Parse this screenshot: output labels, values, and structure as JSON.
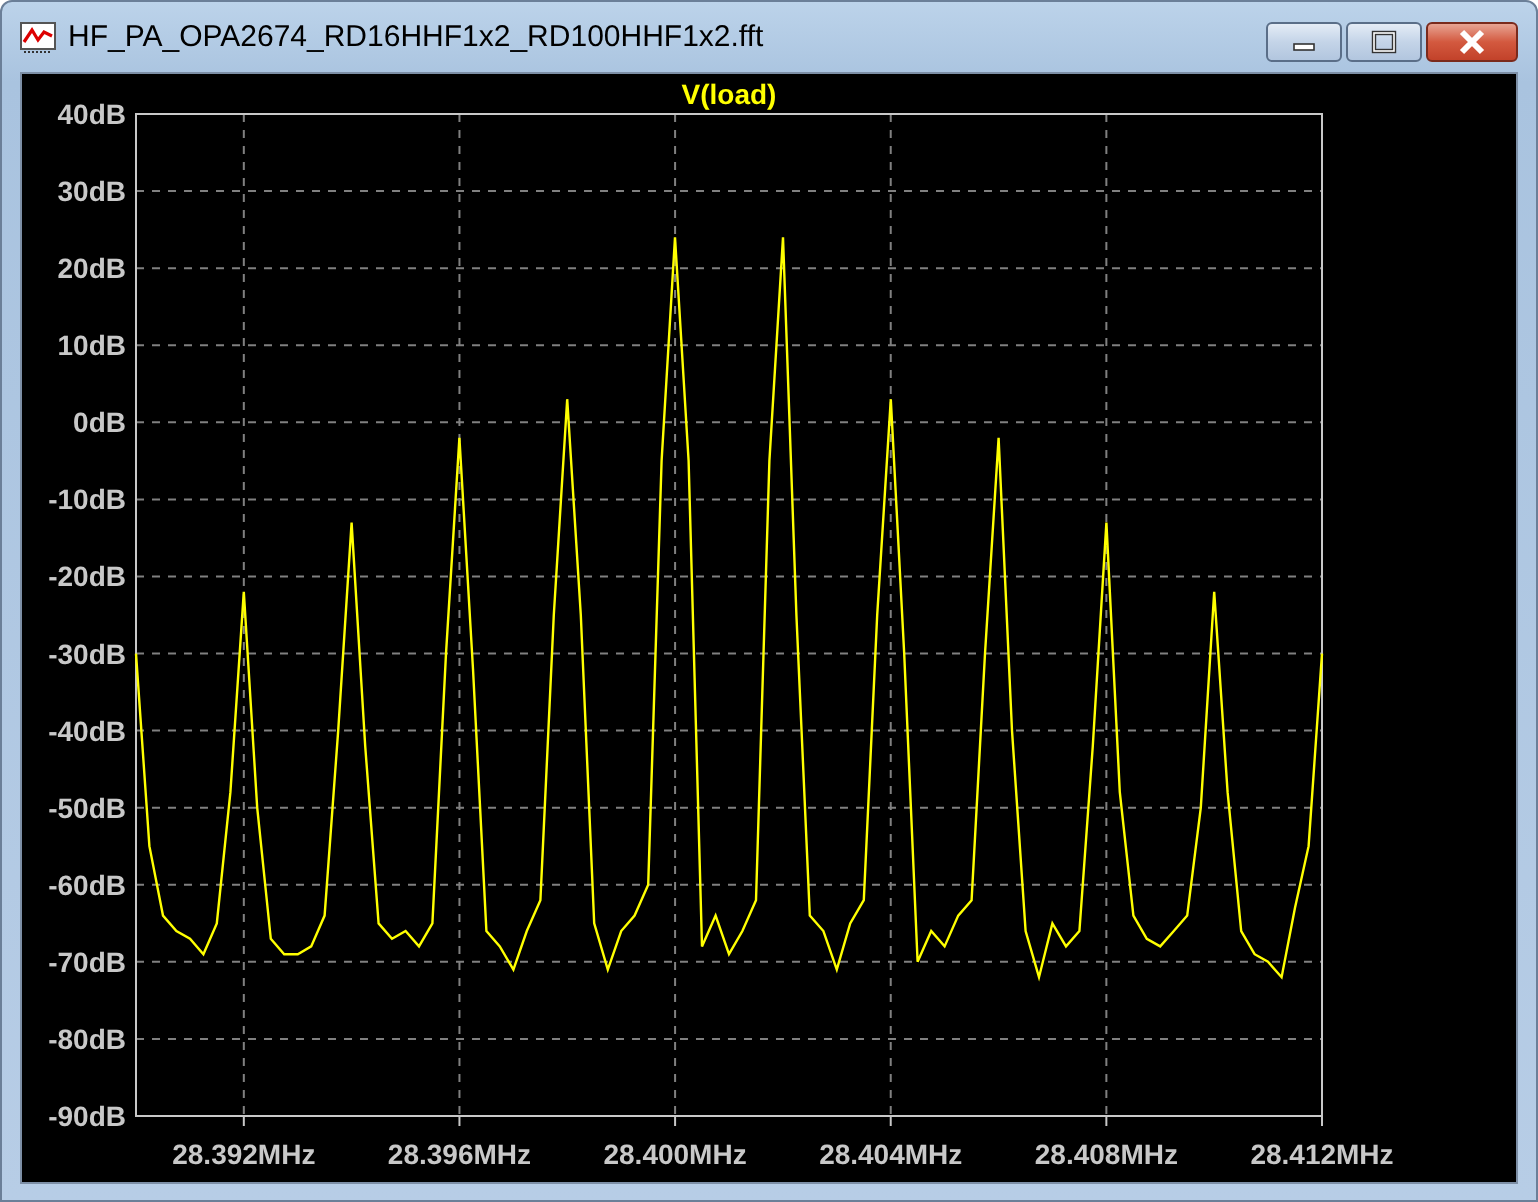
{
  "window": {
    "title": "HF_PA_OPA2674_RD16HHF1x2_RD100HHF1x2.fft"
  },
  "plot": {
    "chart_data": {
      "type": "line",
      "grid": true,
      "xlim": [
        28.39,
        28.412
      ],
      "ylim": [
        -90,
        40
      ],
      "xticks": [
        {
          "value": 28.392,
          "label": "28.392MHz"
        },
        {
          "value": 28.396,
          "label": "28.396MHz"
        },
        {
          "value": 28.4,
          "label": "28.400MHz"
        },
        {
          "value": 28.404,
          "label": "28.404MHz"
        },
        {
          "value": 28.408,
          "label": "28.408MHz"
        },
        {
          "value": 28.412,
          "label": "28.412MHz"
        }
      ],
      "yticks": [
        {
          "value": 40,
          "label": "40dB"
        },
        {
          "value": 30,
          "label": "30dB"
        },
        {
          "value": 20,
          "label": "20dB"
        },
        {
          "value": 10,
          "label": "10dB"
        },
        {
          "value": 0,
          "label": "0dB"
        },
        {
          "value": -10,
          "label": "-10dB"
        },
        {
          "value": -20,
          "label": "-20dB"
        },
        {
          "value": -30,
          "label": "-30dB"
        },
        {
          "value": -40,
          "label": "-40dB"
        },
        {
          "value": -50,
          "label": "-50dB"
        },
        {
          "value": -60,
          "label": "-60dB"
        },
        {
          "value": -70,
          "label": "-70dB"
        },
        {
          "value": -80,
          "label": "-80dB"
        },
        {
          "value": -90,
          "label": "-90dB"
        }
      ],
      "x": [
        28.39,
        28.39025,
        28.3905,
        28.39075,
        28.391,
        28.39125,
        28.3915,
        28.39175,
        28.392,
        28.39225,
        28.3925,
        28.39275,
        28.393,
        28.39325,
        28.3935,
        28.39375,
        28.394,
        28.39425,
        28.3945,
        28.39475,
        28.395,
        28.39525,
        28.3955,
        28.39575,
        28.396,
        28.39625,
        28.3965,
        28.39675,
        28.397,
        28.39725,
        28.3975,
        28.39775,
        28.398,
        28.39825,
        28.3985,
        28.39875,
        28.399,
        28.39925,
        28.3995,
        28.39975,
        28.4,
        28.40025,
        28.4005,
        28.40075,
        28.401,
        28.40125,
        28.4015,
        28.40175,
        28.402,
        28.40225,
        28.4025,
        28.40275,
        28.403,
        28.40325,
        28.4035,
        28.40375,
        28.404,
        28.40425,
        28.4045,
        28.40475,
        28.405,
        28.40525,
        28.4055,
        28.40575,
        28.406,
        28.40625,
        28.4065,
        28.40675,
        28.407,
        28.40725,
        28.4075,
        28.40775,
        28.408,
        28.40825,
        28.4085,
        28.40875,
        28.409,
        28.40925,
        28.4095,
        28.40975,
        28.41,
        28.41025,
        28.4105,
        28.41075,
        28.411,
        28.41125,
        28.4115,
        28.41175,
        28.412
      ],
      "series": [
        {
          "name": "V(load)",
          "color": "#ffff00",
          "values": [
            -30,
            -55,
            -64,
            -66,
            -67,
            -69,
            -65,
            -48,
            -22,
            -50,
            -67,
            -69,
            -69,
            -68,
            -64,
            -40,
            -13,
            -42,
            -65,
            -67,
            -66,
            -68,
            -65,
            -30,
            -2,
            -32,
            -66,
            -68,
            -71,
            -66,
            -62,
            -25,
            3,
            -25,
            -65,
            -71,
            -66,
            -64,
            -60,
            -5,
            24,
            -5,
            -68,
            -64,
            -69,
            -66,
            -62,
            -5,
            24,
            -25,
            -64,
            -66,
            -71,
            -65,
            -62,
            -25,
            3,
            -30,
            -70,
            -66,
            -68,
            -64,
            -62,
            -30,
            -2,
            -40,
            -66,
            -72,
            -65,
            -68,
            -66,
            -42,
            -13,
            -48,
            -64,
            -67,
            -68,
            -66,
            -64,
            -50,
            -22,
            -48,
            -66,
            -69,
            -70,
            -72,
            -63,
            -55,
            -30
          ]
        }
      ]
    }
  }
}
